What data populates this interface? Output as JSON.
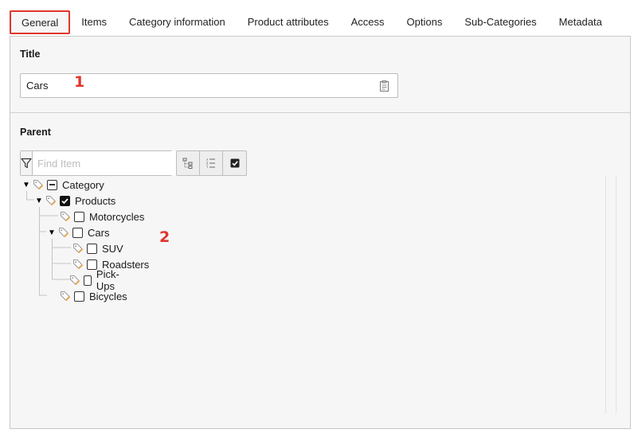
{
  "tabs": [
    {
      "label": "General",
      "active": true
    },
    {
      "label": "Items"
    },
    {
      "label": "Category information"
    },
    {
      "label": "Product attributes"
    },
    {
      "label": "Access"
    },
    {
      "label": "Options"
    },
    {
      "label": "Sub-Categories"
    },
    {
      "label": "Metadata"
    }
  ],
  "title_section": {
    "label": "Title",
    "value": "Cars"
  },
  "parent_section": {
    "label": "Parent",
    "filter_placeholder": "Find Item"
  },
  "annotations": {
    "one": "1",
    "two": "2"
  },
  "tree": [
    {
      "label": "Category",
      "state": "partial",
      "expanded": true
    },
    {
      "label": "Products",
      "state": "checked",
      "expanded": true
    },
    {
      "label": "Motorcycles",
      "state": "unchecked"
    },
    {
      "label": "Cars",
      "state": "unchecked",
      "expanded": true
    },
    {
      "label": "SUV",
      "state": "unchecked"
    },
    {
      "label": "Roadsters",
      "state": "unchecked"
    },
    {
      "label": "Pick-Ups",
      "state": "unchecked"
    },
    {
      "label": "Bicycles",
      "state": "unchecked"
    }
  ],
  "colors": {
    "highlight": "#e0362c",
    "tag_icon": "#f0a23a"
  },
  "icons": [
    "filter-icon",
    "tree-collapse-icon",
    "list-icon",
    "checkbox-icon",
    "clipboard-icon",
    "tag-icon"
  ]
}
